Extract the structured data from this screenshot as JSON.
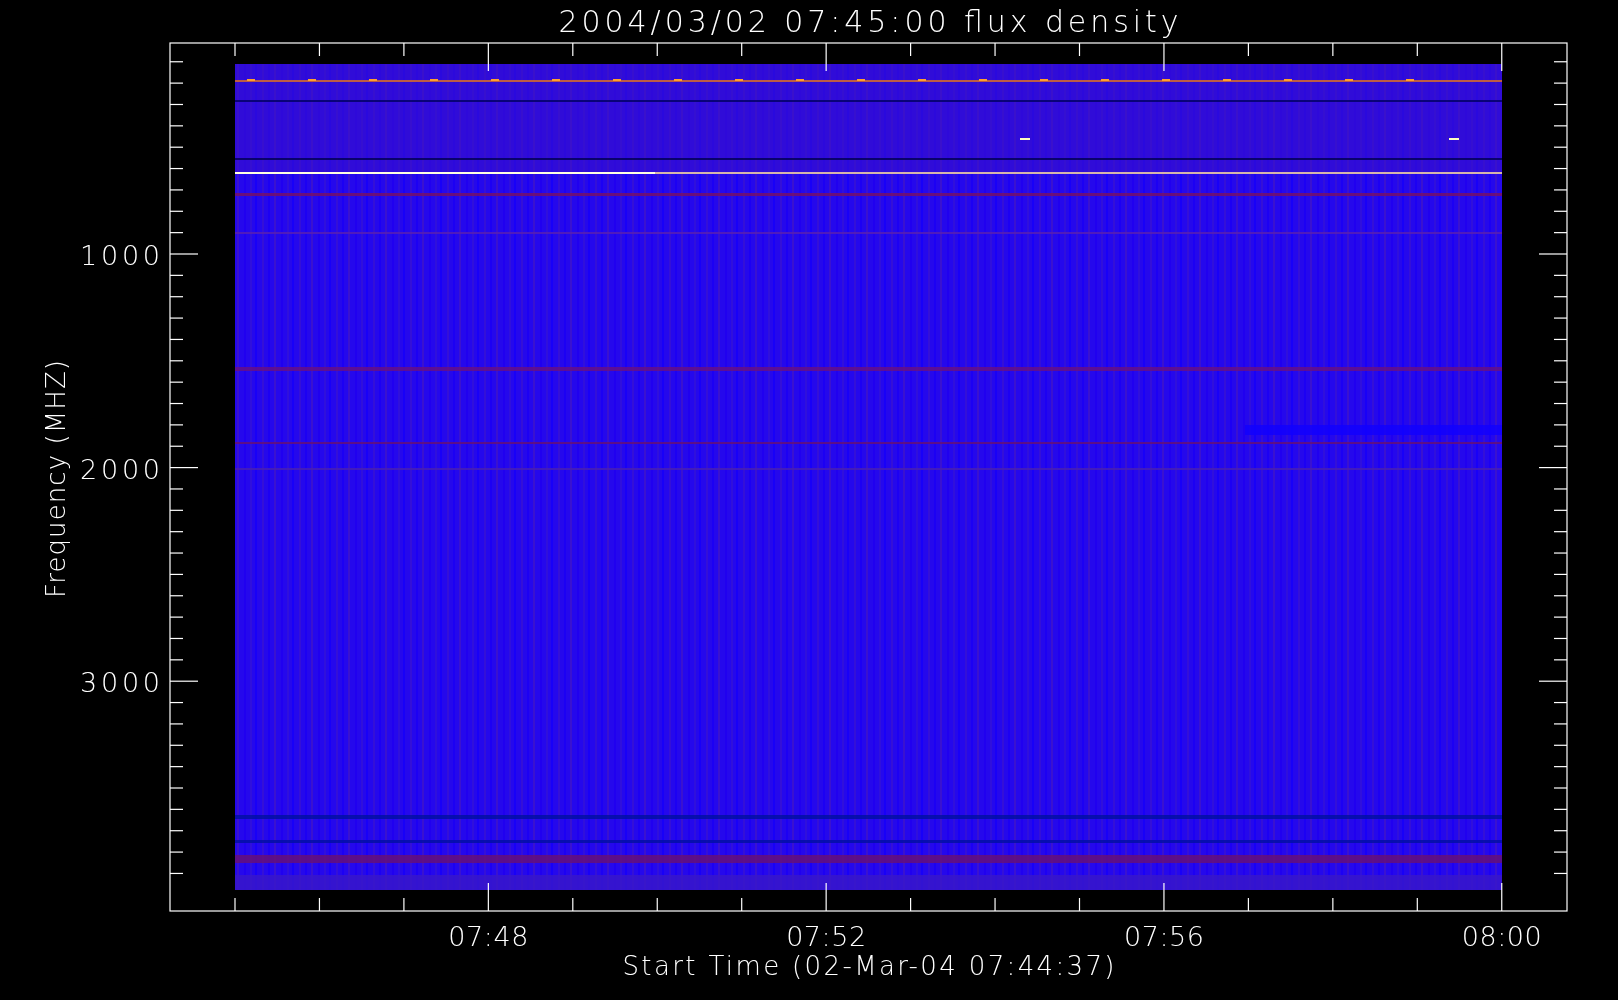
{
  "plot": {
    "title": "2004/03/02 07:45:00 flux density",
    "ylabel": "Frequency (MHZ)",
    "xlabel": "Start Time (02-Mar-04 07:44:37)",
    "yticks": [
      {
        "label": "1000"
      },
      {
        "label": "2000"
      },
      {
        "label": "3000"
      }
    ],
    "xticks": [
      {
        "label": "07:48"
      },
      {
        "label": "07:52"
      },
      {
        "label": "07:56"
      },
      {
        "label": "08:00"
      }
    ]
  }
}
